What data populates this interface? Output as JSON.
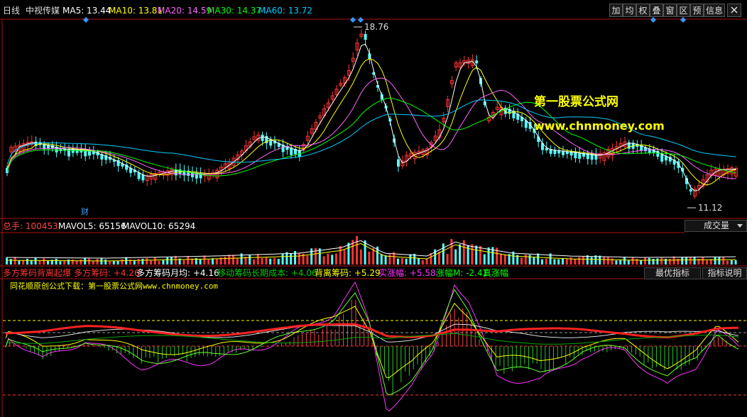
{
  "header": {
    "period": "日线",
    "stock": "中视传媒",
    "mas": [
      {
        "label": "MA5: 13.44",
        "color": "#ffffff"
      },
      {
        "label": "MA10: 13.81",
        "color": "#ffff00"
      },
      {
        "label": "MA20: 14.59",
        "color": "#ff66ff"
      },
      {
        "label": "MA30: 14.37",
        "color": "#00ff00"
      },
      {
        "label": "MA60: 13.72",
        "color": "#00ccff"
      }
    ],
    "toolbar": [
      "加",
      "均",
      "权",
      "叠",
      "窗",
      "区",
      "预",
      "信息"
    ]
  },
  "price_panel": {
    "high_label": "18.76",
    "low_label": "11.12",
    "finance_marker": "财",
    "watermark_cn": "第一股票公式网",
    "watermark_url": "www.chnmoney.com"
  },
  "volume_panel": {
    "label": "总手: 100453",
    "mavol5": "MAVOL5: 65156",
    "mavol10": "MAVOL10: 65294",
    "selector": "成交量",
    "selector_icon": "triangle-down-icon"
  },
  "indicator_panel": {
    "items": [
      {
        "text": "多方筹码背离起爆",
        "color": "#ff3333"
      },
      {
        "text": "多方筹码: +4.26",
        "color": "#ff3333"
      },
      {
        "text": "多方筹码月均: +4.16",
        "color": "#ffffff"
      },
      {
        "text": "移动筹码长期成本: +4.06",
        "color": "#00cc00"
      },
      {
        "text": "背离筹码: +5.29",
        "color": "#ffff00"
      },
      {
        "text": "实涨幅: +5.58",
        "color": "#ff33ff"
      },
      {
        "text": "涨幅M: -2.41",
        "color": "#00ff00"
      },
      {
        "text": "真涨幅",
        "color": "#00ff00"
      }
    ],
    "btn_best": "最优指标",
    "btn_help": "指标说明",
    "download_note": "同花顺原创公式下载：第一股票公式网www.chnmoney.com"
  },
  "chart_data": {
    "type": "candlestick",
    "price_high": 18.76,
    "price_low": 11.12,
    "ma_legend": [
      "MA5",
      "MA10",
      "MA20",
      "MA30",
      "MA60"
    ],
    "ma_latest": [
      13.44,
      13.81,
      14.59,
      14.37,
      13.72
    ],
    "volume_latest": 100453,
    "mavol5": 65156,
    "mavol10": 65294
  }
}
